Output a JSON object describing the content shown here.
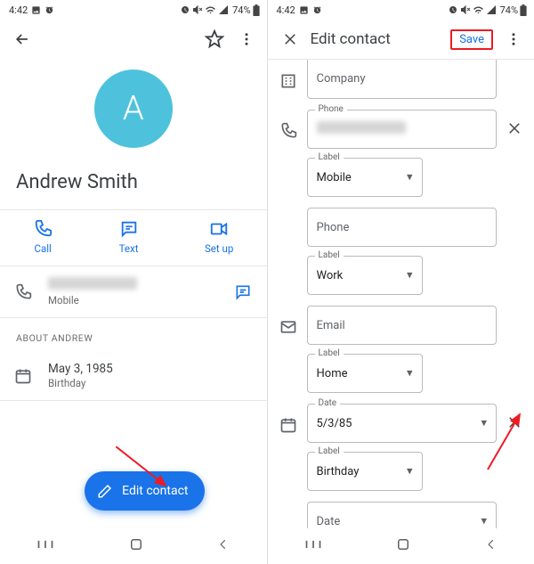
{
  "status": {
    "time": "4:42",
    "battery": "74%"
  },
  "left": {
    "contact_name": "Andrew Smith",
    "avatar_letter": "A",
    "actions": {
      "call": "Call",
      "text": "Text",
      "setup": "Set up"
    },
    "phone_label": "Mobile",
    "about_header": "ABOUT ANDREW",
    "bday_date": "May 3, 1985",
    "bday_label": "Birthday",
    "fab_label": "Edit contact"
  },
  "right": {
    "title": "Edit contact",
    "save": "Save",
    "fields": {
      "company_ph": "Company",
      "phone_float": "Phone",
      "label_float": "Label",
      "mobile": "Mobile",
      "phone2_ph": "Phone",
      "work": "Work",
      "email_ph": "Email",
      "home": "Home",
      "date_float": "Date",
      "date_val": "5/3/85",
      "birthday": "Birthday",
      "date2_ph": "Date"
    }
  }
}
